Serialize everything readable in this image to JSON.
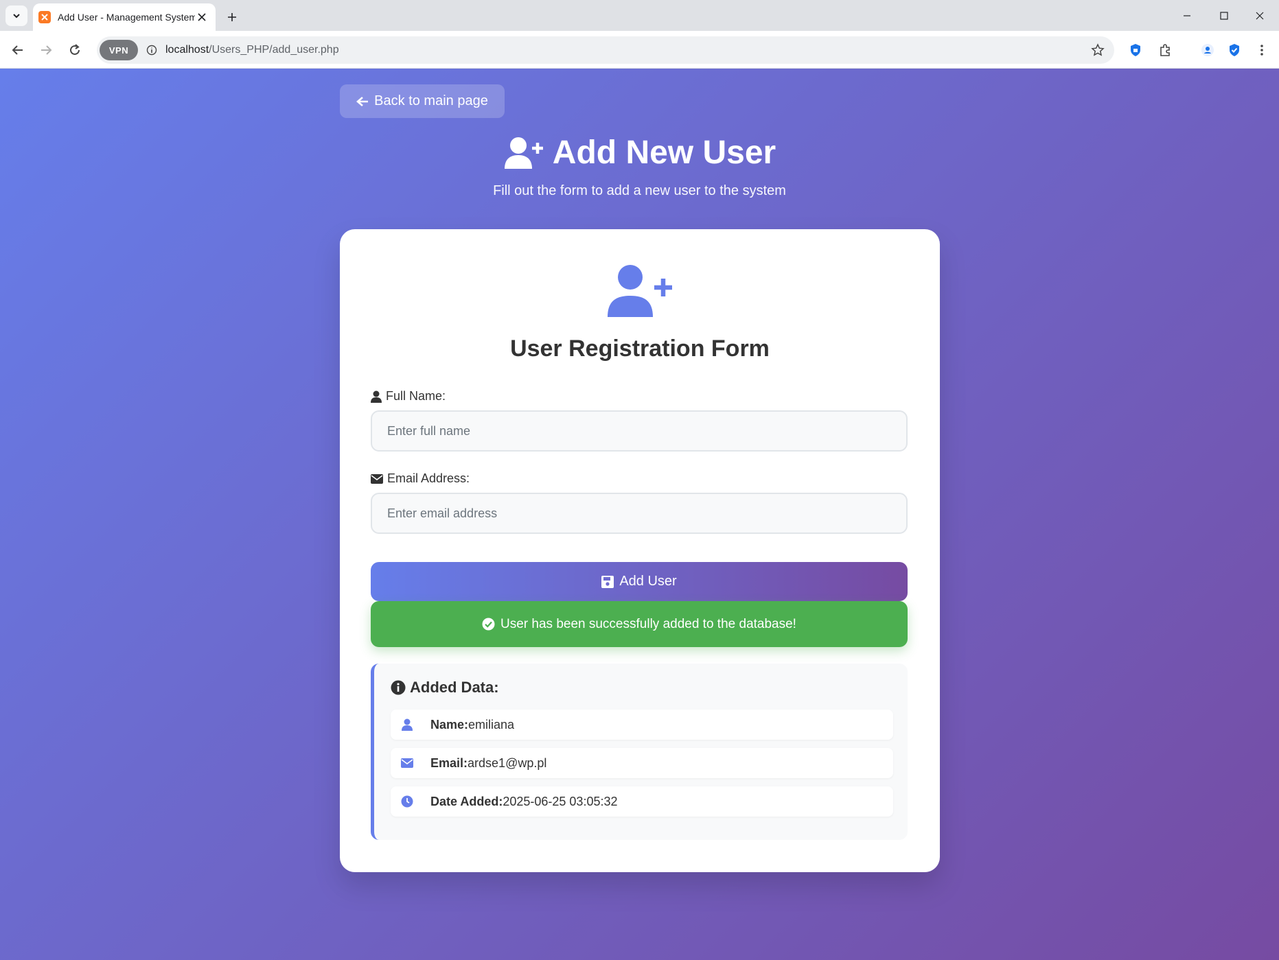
{
  "browser": {
    "tab_title": "Add User - Management System",
    "vpn_label": "VPN",
    "url_host": "localhost",
    "url_path": "/Users_PHP/add_user.php"
  },
  "page": {
    "back_label": "Back to main page",
    "title": "Add New User",
    "subtitle": "Fill out the form to add a new user to the system"
  },
  "form": {
    "title": "User Registration Form",
    "name_label": "Full Name:",
    "name_placeholder": "Enter full name",
    "name_value": "",
    "email_label": "Email Address:",
    "email_placeholder": "Enter email address",
    "email_value": "",
    "submit_label": "Add User"
  },
  "alert": {
    "success": "User has been successfully added to the database!"
  },
  "added": {
    "title": "Added Data:",
    "name_key": "Name:",
    "name_value": "emiliana",
    "email_key": "Email:",
    "email_value": "ardse1@wp.pl",
    "date_key": "Date Added:",
    "date_value": "2025-06-25 03:05:32"
  },
  "colors": {
    "gradient_start": "#667eea",
    "gradient_end": "#764ba2",
    "success": "#4caf50"
  }
}
